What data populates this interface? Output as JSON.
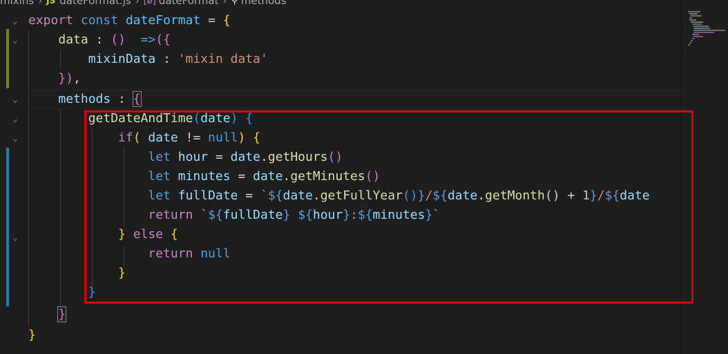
{
  "breadcrumb": {
    "folder": "mixins",
    "file_icon": "JS",
    "file": "dateFormat.js",
    "symbol": "dateFormat",
    "method": "methods"
  },
  "code": {
    "l1_kw_export": "export",
    "l1_kw_const": "const",
    "l1_name": "dateFormat",
    "l1_rest": " = ",
    "l1_brace": "{",
    "l2_data": "data",
    "l2_colon": " : ",
    "l2_paren": "()",
    "l2_arrow": "  =>",
    "l2_open": "({",
    "l3_key": "mixinData",
    "l3_colon": " : ",
    "l3_value": "'mixin data'",
    "l4_close": "})",
    "l4_comma": ",",
    "l5_methods": "methods",
    "l5_colon": " : ",
    "l5_brace": "{",
    "l6_fn": "getDateAndTime",
    "l6_paren_open": "(",
    "l6_param": "date",
    "l6_paren_close": ")",
    "l6_brace": " {",
    "l7_if": "if",
    "l7_paren": "( ",
    "l7_date": "date",
    "l7_op": " != ",
    "l7_null": "null",
    "l7_close": ") {",
    "l8_let": "let",
    "l8_var": "hour",
    "l8_eq": " = ",
    "l8_obj": "date",
    "l8_dot": ".",
    "l8_fn": "getHours",
    "l8_call": "()",
    "l9_let": "let",
    "l9_var": "minutes",
    "l9_eq": " = ",
    "l9_obj": "date",
    "l9_dot": ".",
    "l9_fn": "getMinutes",
    "l9_call": "()",
    "l10_let": "let",
    "l10_var": "fullDate",
    "l10_eq": " = ",
    "l10_tick": "`",
    "l10_s1": "${",
    "l10_obj1": "date",
    "l10_fn1": ".getFullYear",
    "l10_c1": "()",
    "l10_e1": "}",
    "l10_slash1": "/",
    "l10_s2": "${",
    "l10_obj2": "date",
    "l10_fn2": ".getMonth",
    "l10_c2": "() + ",
    "l10_num": "1",
    "l10_e2": "}",
    "l10_slash2": "/",
    "l10_s3": "${",
    "l10_obj3": "date",
    "l11_return": "return",
    "l11_tick": " `",
    "l11_s1": "${",
    "l11_v1": "fullDate",
    "l11_e1": "}",
    "l11_sp": " ",
    "l11_s2": "${",
    "l11_v2": "hour",
    "l11_e2": "}",
    "l11_colon": ":",
    "l11_s3": "${",
    "l11_v3": "minutes",
    "l11_e3": "}",
    "l11_tick_end": "`",
    "l12_close": "} ",
    "l12_else": "else",
    "l12_open": " {",
    "l13_return": "return",
    "l13_null": "null",
    "l14_close": "}",
    "l15_close": "}",
    "l16_close": "}",
    "l17_close": "}"
  },
  "colors": {
    "keyword": "#569cd6",
    "control": "#c586c0",
    "function": "#dcdcaa",
    "variable": "#9cdcfe",
    "string": "#ce9178",
    "highlight_box": "#e00000"
  },
  "icons": [
    "js-file-icon",
    "symbol-variable-icon",
    "symbol-method-icon",
    "fold-chevron-icon"
  ]
}
